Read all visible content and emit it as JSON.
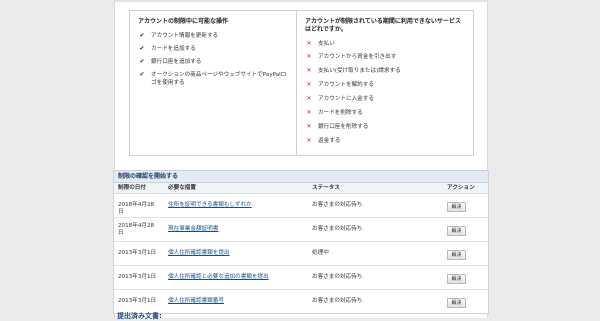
{
  "capabilities": {
    "allowed_heading": "アカウントの制限中に可能な操作",
    "allowed_items": [
      "アカウント情報を更新する",
      "カードを追加する",
      "銀行口座を追加する",
      "オークションの商品ページやウェブサイトでPayPalロゴを使用する"
    ],
    "blocked_heading": "アカウントが制限されている期間に利用できないサービスはどれですか。",
    "blocked_items": [
      "支払い",
      "アカウントから資金を引き出す",
      "支払い(受け取りまたは)請求する",
      "アカウントを解約する",
      "アカウントに入金する",
      "カードを削除する",
      "銀行口座を削除する",
      "返金する"
    ],
    "check_symbol": "✔",
    "cross_symbol": "✕"
  },
  "limitation_panel": {
    "title": "制限の確認を開始する",
    "columns": [
      "制限の日付",
      "必要な措置",
      "ステータス",
      "アクション"
    ],
    "rows": [
      {
        "date": "2018年4月28日",
        "action": "住所を証明できる書類もしずれか",
        "status": "お客さまの対応待ち",
        "button": "解決"
      },
      {
        "date": "2018年4月28日",
        "action": "現在事業金額証明書",
        "status": "お客さまの対応待ち",
        "button": "解決"
      },
      {
        "date": "2013年3月1日",
        "action": "個人住所確認書類を提出",
        "status": "処理中",
        "button": "解決"
      },
      {
        "date": "2013年3月1日",
        "action": "個人住所確認と必要な追加の書類を提出",
        "status": "お客さまの対応待ち",
        "button": "解決"
      },
      {
        "date": "2013年3月1日",
        "action": "個人住所確認書類番号",
        "status": "お客さまの対応待ち",
        "button": "解決"
      }
    ]
  },
  "submitted_heading": "提出済み文書:"
}
